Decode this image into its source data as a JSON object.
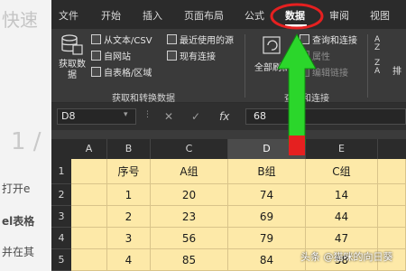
{
  "background_page": {
    "title_fragment": "快速",
    "number_fragment": "1 /",
    "lines": [
      "打开e",
      "el表格",
      "并在其"
    ]
  },
  "ribbon_tabs": [
    "文件",
    "开始",
    "插入",
    "页面布局",
    "公式",
    "数据",
    "审阅",
    "视图"
  ],
  "active_tab": "数据",
  "ribbon": {
    "get_data_label": "获取数\n据",
    "items": [
      "从文本/CSV",
      "自网站",
      "自表格/区域",
      "最近使用的源",
      "现有连接"
    ],
    "group1_label": "获取和转换数据",
    "refresh_all_label": "全部刷新",
    "right_items": [
      "查询和连接",
      "属性",
      "编辑链接"
    ],
    "group2_label": "查询和连接",
    "sort_label": "排"
  },
  "formula_bar": {
    "name_box": "D8",
    "cancel_symbol": "✕",
    "enter_symbol": "✓",
    "fx_symbol": "fx",
    "value": "68"
  },
  "columns": [
    "A",
    "B",
    "C",
    "D",
    "E"
  ],
  "selected_column": "D",
  "row_numbers": [
    "1",
    "2",
    "3",
    "4",
    "5"
  ],
  "table": {
    "headers": [
      "序号",
      "A组",
      "B组",
      "C组"
    ],
    "rows": [
      [
        "1",
        "20",
        "74",
        "14"
      ],
      [
        "2",
        "23",
        "69",
        "44"
      ],
      [
        "3",
        "56",
        "79",
        "47"
      ],
      [
        "4",
        "85",
        "84",
        "58"
      ]
    ]
  },
  "annotation": {
    "highlight_color": "#e52020",
    "arrow_color": "#2bd62b"
  },
  "watermark": "头条 @猫咪的向日葵"
}
